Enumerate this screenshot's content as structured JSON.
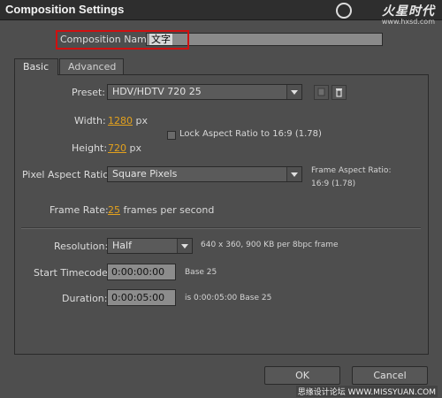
{
  "window": {
    "title": "Composition Settings"
  },
  "watermark": {
    "brand": "火星时代",
    "url": "www.hxsd.com",
    "bottom": "思缘设计论坛  WWW.MISSYUAN.COM"
  },
  "comp_name": {
    "label": "Composition Name:",
    "value": "文字"
  },
  "tabs": [
    {
      "label": "Basic",
      "active": true
    },
    {
      "label": "Advanced",
      "active": false
    }
  ],
  "preset": {
    "label": "Preset:",
    "value": "HDV/HDTV 720 25"
  },
  "width": {
    "label": "Width:",
    "value": "1280",
    "unit": "px"
  },
  "height": {
    "label": "Height:",
    "value": "720",
    "unit": "px"
  },
  "lock_aspect": {
    "label": "Lock Aspect Ratio to 16:9 (1.78)",
    "checked": false
  },
  "pixel_aspect": {
    "label": "Pixel Aspect Ratio:",
    "value": "Square Pixels"
  },
  "frame_aspect": {
    "label": "Frame Aspect Ratio:",
    "value": "16:9 (1.78)"
  },
  "frame_rate": {
    "label": "Frame Rate:",
    "value": "25",
    "unit": "frames per second"
  },
  "resolution": {
    "label": "Resolution:",
    "value": "Half",
    "info": "640 x 360, 900 KB per 8bpc frame"
  },
  "start_timecode": {
    "label": "Start Timecode:",
    "value": "0:00:00:00",
    "base": "Base 25"
  },
  "duration": {
    "label": "Duration:",
    "value": "0:00:05:00",
    "info": "is 0:00:05:00  Base 25"
  },
  "buttons": {
    "ok": "OK",
    "cancel": "Cancel"
  },
  "colors": {
    "accent_value": "#e3a11d",
    "highlight_border": "#d01010",
    "background": "#4e4e4e"
  }
}
